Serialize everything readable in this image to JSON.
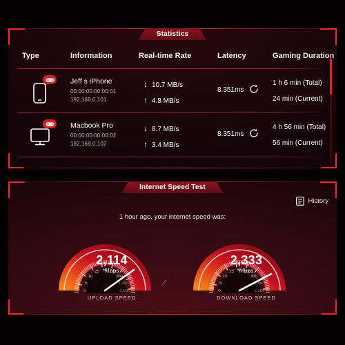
{
  "statistics": {
    "banner_title": "Statistics",
    "columns": [
      "Type",
      "Information",
      "Real-time Rate",
      "Latency",
      "Gaming Duration"
    ],
    "rows": [
      {
        "device_icon": "smartphone-icon",
        "badge_icon": "gamepad-icon",
        "name": "Jeff s iPhone",
        "mac": "00:00:00:00:00:01",
        "ip": "192.168.0.101",
        "download_rate": "10.7 MB/s",
        "upload_rate": "4.8 MB/s",
        "download_arrow": "↓",
        "upload_arrow": "↑",
        "latency": "8.351ms",
        "refresh_icon": "refresh-icon",
        "duration_total": "1 h 6 min (Total)",
        "duration_current": "24 min (Current)"
      },
      {
        "device_icon": "desktop-monitor-icon",
        "badge_icon": "gamepad-icon",
        "name": "Macbook Pro",
        "mac": "00:00:00:00:00:02",
        "ip": "192.168.0.102",
        "download_rate": "8.7 MB/s",
        "upload_rate": "3.4 MB/s",
        "download_arrow": "↓",
        "upload_arrow": "↑",
        "latency": "8.351ms",
        "refresh_icon": "refresh-icon",
        "duration_total": "4 h 56 min (Total)",
        "duration_current": "56 min (Current)"
      }
    ]
  },
  "speed_test": {
    "banner_title": "Internet Speed Test",
    "history_label": "History",
    "history_icon": "list-document-icon",
    "caption": "1 hour ago, your internet speed was:",
    "gauges": [
      {
        "label": "UPLOAD SPEED",
        "value": "2,114",
        "unit": "Mbps",
        "ticks": [
          "0",
          "5",
          "10",
          "25",
          "50",
          "100",
          "300",
          "1,000",
          "2,500"
        ],
        "needle_angle_deg": 58
      },
      {
        "label": "DOWNLOAD SPEED",
        "value": "2,333",
        "unit": "Mbps",
        "ticks": [
          "0",
          "5",
          "10",
          "25",
          "50",
          "100",
          "300",
          "1,000",
          "2,500"
        ],
        "needle_angle_deg": 64
      }
    ]
  },
  "colors": {
    "accent_red": "#ff2233",
    "banner_red": "#8d1420",
    "badge_red": "#d3202f",
    "gauge_orange": "#ff7a1a",
    "text_primary": "#ffffff",
    "text_muted": "#c7b9bd"
  }
}
